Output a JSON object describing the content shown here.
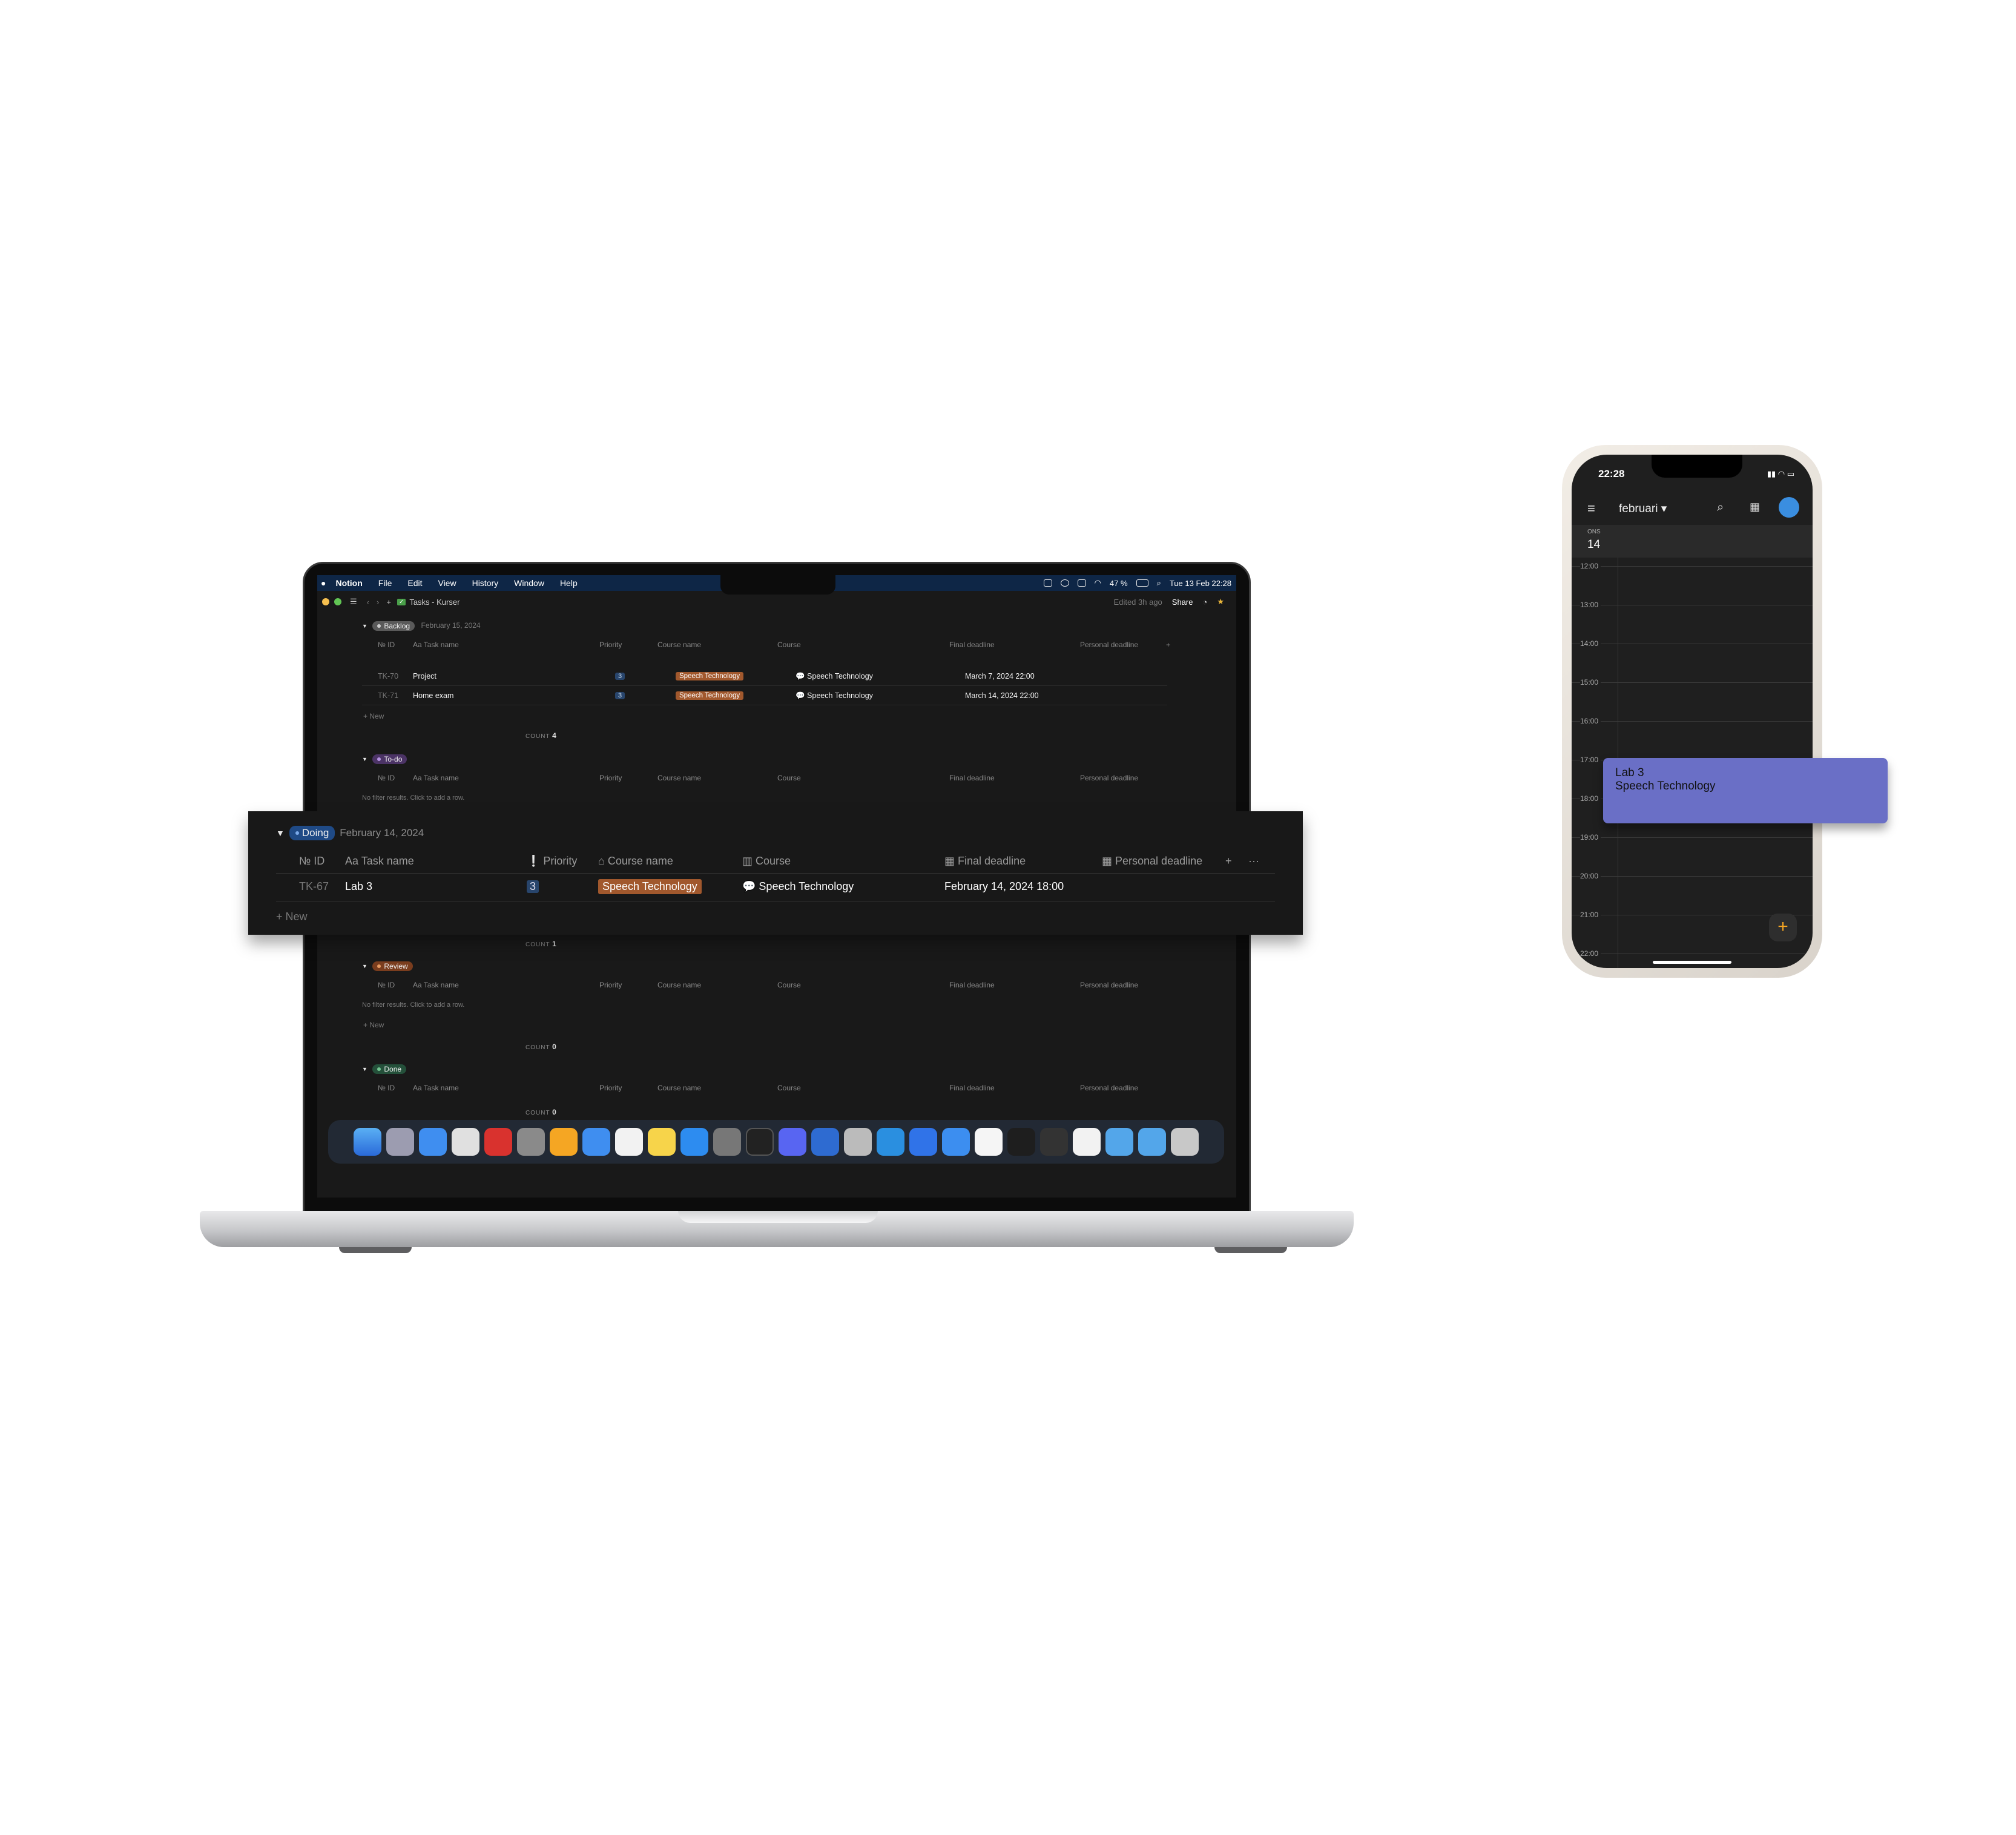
{
  "menubar": {
    "app": "Notion",
    "items": [
      "File",
      "Edit",
      "View",
      "History",
      "Window",
      "Help"
    ],
    "battery": "47 %",
    "datetime": "Tue 13 Feb  22:28"
  },
  "topbar": {
    "page_title": "Tasks - Kurser",
    "edited": "Edited 3h ago",
    "share": "Share"
  },
  "columns": {
    "id": "№ ID",
    "task": "Aa Task name",
    "priority": "Priority",
    "course_name": "Course name",
    "course": "Course",
    "final": "Final deadline",
    "personal": "Personal deadline"
  },
  "groups": {
    "backlog": {
      "label": "Backlog",
      "date": "February 15, 2024",
      "rows": [
        {
          "id": "TK-70",
          "task": "Project",
          "priority": "3",
          "course_name": "Speech Technology",
          "course": "Speech Technology",
          "final": "March 7, 2024 22:00"
        },
        {
          "id": "TK-71",
          "task": "Home exam",
          "priority": "3",
          "course_name": "Speech Technology",
          "course": "Speech Technology",
          "final": "March 14, 2024 22:00"
        }
      ],
      "count_label": "COUNT",
      "count": "4"
    },
    "todo": {
      "label": "To-do",
      "empty": "No filter results. Click to add a row."
    },
    "doing": {
      "label": "Doing",
      "date": "February 14, 2024",
      "row": {
        "id": "TK-67",
        "task": "Lab 3",
        "priority": "3",
        "course_name": "Speech Technology",
        "course": "Speech Technology",
        "final": "February 14, 2024 18:00"
      },
      "new": "New",
      "count": "1"
    },
    "review": {
      "label": "Review",
      "empty": "No filter results. Click to add a row.",
      "count": "0"
    },
    "done": {
      "label": "Done",
      "count": "0"
    }
  },
  "new_label": "New",
  "colors": {
    "menubar": "#0e2646",
    "backlog": "#5a5a5a",
    "todo": "#4b3365",
    "doing": "#1f4a86",
    "review": "#7a3d1e",
    "done": "#24503a",
    "tag": "#a1582d",
    "event": "#6a6fc6"
  },
  "phone": {
    "time": "22:28",
    "month": "februari",
    "weekday": "ONS",
    "day": "14",
    "hours": [
      "12:00",
      "13:00",
      "14:00",
      "15:00",
      "16:00",
      "17:00",
      "18:00",
      "19:00",
      "20:00",
      "21:00",
      "22:00"
    ],
    "event_title": "Lab 3",
    "event_subtitle": "Speech Technology"
  }
}
